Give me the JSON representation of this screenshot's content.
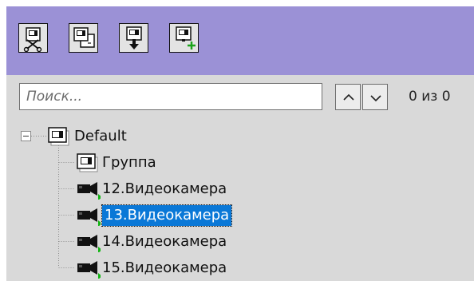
{
  "toolbar": {
    "buttons": [
      {
        "name": "cut-camera-button",
        "icon": "camera-cut-icon"
      },
      {
        "name": "copy-camera-button",
        "icon": "camera-copy-icon"
      },
      {
        "name": "paste-camera-button",
        "icon": "camera-paste-icon"
      },
      {
        "name": "add-camera-button",
        "icon": "camera-add-icon"
      }
    ],
    "accent_color": "#9b91d6"
  },
  "search": {
    "placeholder": "Поиск...",
    "value": "",
    "counter": "0 из 0"
  },
  "tree": {
    "root": {
      "label": "Default",
      "expanded": true,
      "icon": "group-icon"
    },
    "children": [
      {
        "label": "Группа",
        "icon": "group-icon",
        "selected": false
      },
      {
        "label": "12.Видеокамера",
        "icon": "video-camera-icon",
        "selected": false
      },
      {
        "label": "13.Видеокамера",
        "icon": "video-camera-icon",
        "selected": true
      },
      {
        "label": "14.Видеокамера",
        "icon": "video-camera-icon",
        "selected": false
      },
      {
        "label": "15.Видеокамера",
        "icon": "video-camera-icon",
        "selected": false
      }
    ],
    "selection_color": "#0a78d7"
  }
}
